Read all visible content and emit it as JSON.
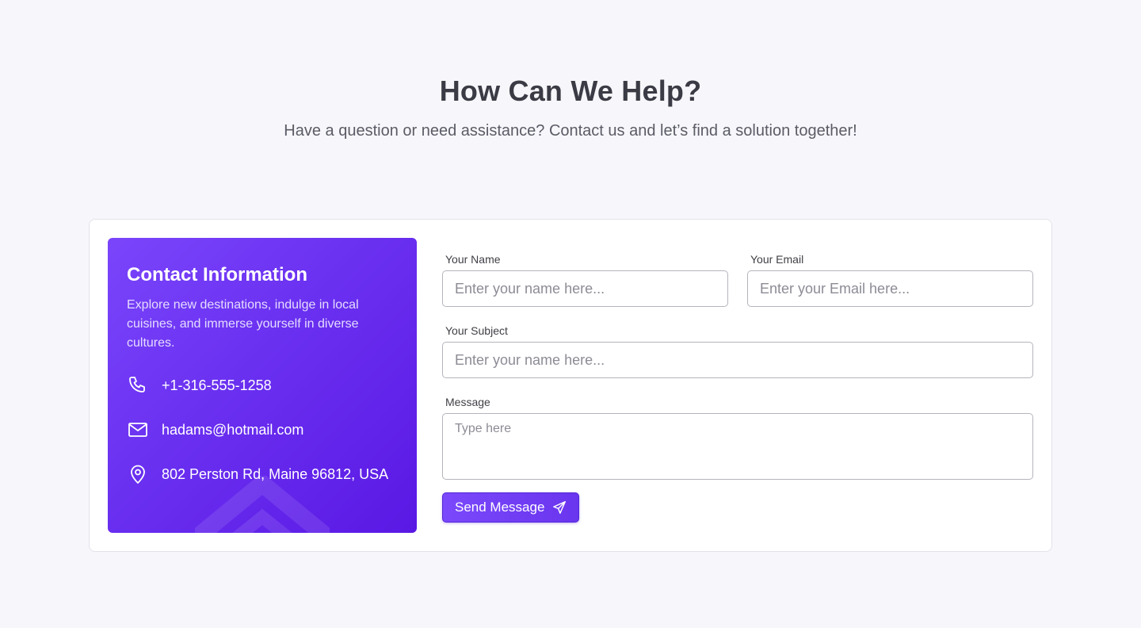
{
  "hero": {
    "title": "How Can We Help?",
    "subtitle": "Have a question or need assistance? Contact us and let’s find a solution together!"
  },
  "contact_info": {
    "title": "Contact Information",
    "description": "Explore new destinations, indulge in local cuisines, and immerse yourself in diverse cultures.",
    "phone": "+1-316-555-1258",
    "email": "hadams@hotmail.com",
    "address": "802 Perston Rd, Maine 96812, USA",
    "icons": {
      "phone": "phone-icon",
      "email": "mail-icon",
      "address": "map-pin-icon"
    }
  },
  "form": {
    "name": {
      "label": "Your Name",
      "placeholder": "Enter your name here...",
      "value": ""
    },
    "email": {
      "label": "Your Email",
      "placeholder": "Enter your Email here...",
      "value": ""
    },
    "subject": {
      "label": "Your Subject",
      "placeholder": "Enter your name here...",
      "value": ""
    },
    "message": {
      "label": "Message",
      "placeholder": "Type here",
      "value": ""
    },
    "submit_label": "Send Message",
    "submit_icon": "send-icon"
  },
  "colors": {
    "accent": "#6a30f0",
    "accent_light": "#7a45fb",
    "page_bg": "#f7f7fb",
    "heading": "#3b3b45"
  }
}
